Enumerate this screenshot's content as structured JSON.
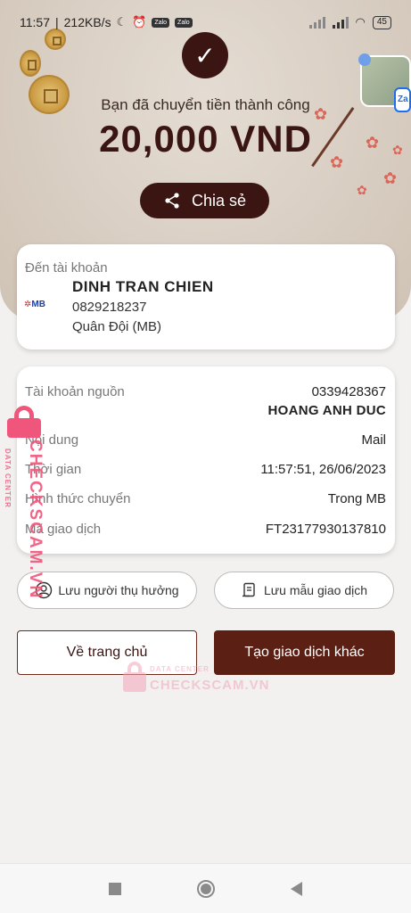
{
  "status_bar": {
    "time": "11:57",
    "net_speed": "212KB/s",
    "battery": "45"
  },
  "header": {
    "success_message": "Bạn đã chuyển tiền thành công",
    "amount": "20,000 VND",
    "share_label": "Chia sẻ"
  },
  "recipient": {
    "label": "Đến tài khoản",
    "bank_logo": "MB",
    "name": "DINH TRAN CHIEN",
    "account_number": "0829218237",
    "bank_name": "Quân Đội (MB)"
  },
  "details": {
    "source_label": "Tài khoản nguồn",
    "source_account": "0339428367",
    "source_name": "HOANG ANH DUC",
    "content_label": "Nội dung",
    "content_value": "Mail",
    "time_label": "Thời gian",
    "time_value": "11:57:51, 26/06/2023",
    "method_label": "Hình thức chuyển",
    "method_value": "Trong MB",
    "txn_label": "Mã giao dịch",
    "txn_value": "FT23177930137810"
  },
  "actions": {
    "save_beneficiary": "Lưu người thụ hưởng",
    "save_template": "Lưu mẫu giao dịch",
    "home": "Về trang chủ",
    "new_transaction": "Tạo giao dịch khác"
  },
  "watermark": {
    "brand": "CHECKSCAM.VN",
    "sub": "DATA CENTER"
  },
  "floating_bubble": {
    "label": "Za"
  },
  "colors": {
    "primary": "#3a1512",
    "accent_button": "#5b1f14",
    "watermark": "#f0567b"
  }
}
